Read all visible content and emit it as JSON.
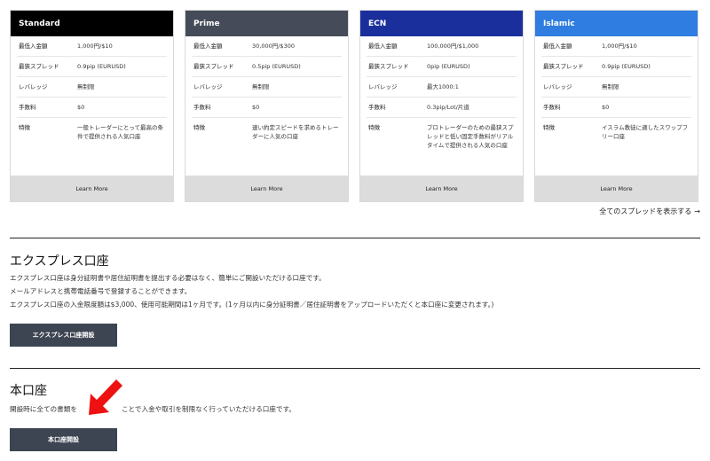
{
  "cards": [
    {
      "name": "Standard",
      "header_color": "#000000",
      "rows": [
        {
          "label": "最低入金額",
          "value": "1,000円/$10"
        },
        {
          "label": "最狭スプレッド",
          "value": "0.9pip (EURUSD)"
        },
        {
          "label": "レバレッジ",
          "value": "無制限"
        },
        {
          "label": "手数料",
          "value": "$0"
        },
        {
          "label": "特徴",
          "value": "一般トレーダーにとって最高の条件で提供される人気口座"
        }
      ],
      "button": "Learn More"
    },
    {
      "name": "Prime",
      "header_color": "#454b58",
      "rows": [
        {
          "label": "最低入金額",
          "value": "30,000円/$300"
        },
        {
          "label": "最狭スプレッド",
          "value": "0.5pip (EURUSD)"
        },
        {
          "label": "レバレッジ",
          "value": "無制限"
        },
        {
          "label": "手数料",
          "value": "$0"
        },
        {
          "label": "特徴",
          "value": "速い約定スピードを求めるトレーダーに人気の口座"
        }
      ],
      "button": "Learn More"
    },
    {
      "name": "ECN",
      "header_color": "#1b2f9c",
      "rows": [
        {
          "label": "最低入金額",
          "value": "100,000円/$1,000"
        },
        {
          "label": "最狭スプレッド",
          "value": "0pip (EURUSD)"
        },
        {
          "label": "レバレッジ",
          "value": "最大1000:1"
        },
        {
          "label": "手数料",
          "value": "0.3pip/Lot/片道"
        },
        {
          "label": "特徴",
          "value": "プロトレーダーのための最狭スプレッドと低い固定手数料がリアルタイムで提供される人気の口座"
        }
      ],
      "button": "Learn More"
    },
    {
      "name": "Islamic",
      "header_color": "#2f7de0",
      "rows": [
        {
          "label": "最低入金額",
          "value": "1,000円/$10"
        },
        {
          "label": "最狭スプレッド",
          "value": "0.9pip (EURUSD)"
        },
        {
          "label": "レバレッジ",
          "value": "無制限"
        },
        {
          "label": "手数料",
          "value": "$0"
        },
        {
          "label": "特徴",
          "value": "イスラム教徒に適したスワップフリー口座"
        }
      ],
      "button": "Learn More"
    }
  ],
  "spread_link": {
    "label": "全てのスプレッドを表示する",
    "arrow": "→"
  },
  "express": {
    "title": "エクスプレス口座",
    "lines": [
      "エクスプレス口座は身分証明書や居住証明書を提出する必要はなく、簡単にご開設いただける口座です。",
      "メールアドレスと携帯電話番号で登録することができます。",
      "エクスプレス口座の入金限度額は$3,000、使用可能期間は1ヶ月です。(1ヶ月以内に身分証明書／居住証明書をアップロードいただくと本口座に変更されます。)"
    ],
    "button": "エクスプレス口座開設"
  },
  "real": {
    "title": "本口座",
    "line_before": "開設時に全ての書類を",
    "line_after": "ことで入金や取引を制限なく行っていただける口座です。",
    "button": "本口座開設"
  },
  "colors": {
    "button_bg": "#3d4452",
    "arrow": "#ee1111",
    "learn_more_bg": "#dcdcdc"
  }
}
